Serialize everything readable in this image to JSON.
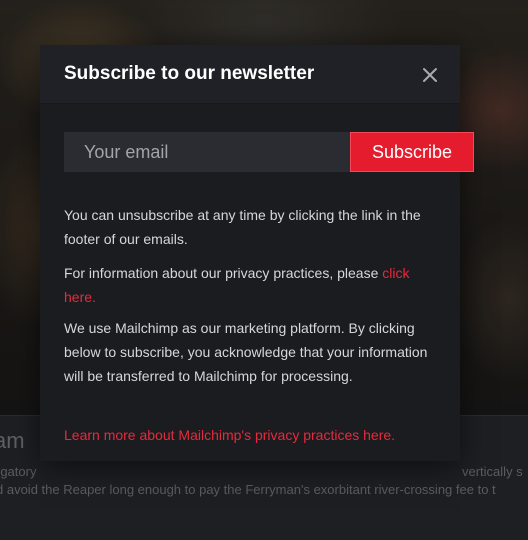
{
  "background": {
    "title": "am",
    "desc_line1_left": "rgatory",
    "desc_line1_right": "vertically s",
    "desc_line2": "d avoid the Reaper long enough to pay the Ferryman's exorbitant river-crossing fee to t"
  },
  "modal": {
    "title": "Subscribe to our newsletter",
    "close_icon": "close-icon",
    "email_placeholder": "Your email",
    "subscribe_label": "Subscribe",
    "unsubscribe_text": "You can unsubscribe at any time by clicking the link in the footer of our emails.",
    "privacy_text": "For information about our privacy practices, please ",
    "privacy_link": "click here.",
    "mailchimp_text": "We use Mailchimp as our marketing platform. By clicking below to subscribe, you acknowledge that your information will be transferred to Mailchimp for processing.",
    "mailchimp_link": "Learn more about Mailchimp's privacy practices here."
  },
  "colors": {
    "accent": "#e51b2e",
    "link": "#e8293c",
    "modal_bg": "#1b1c20"
  }
}
